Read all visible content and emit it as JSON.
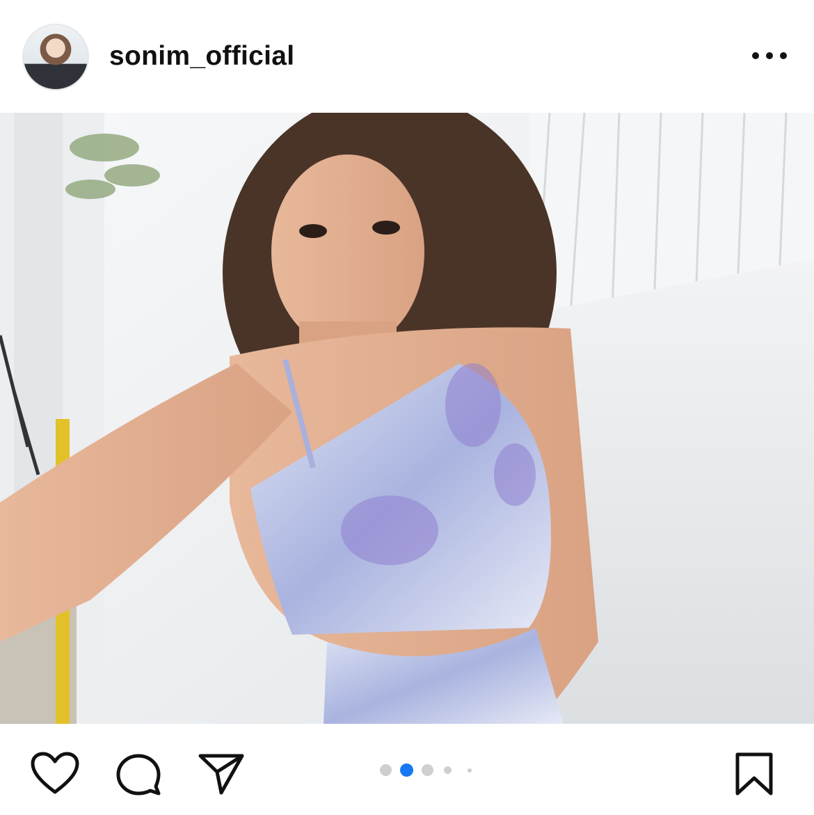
{
  "post": {
    "username": "sonim_official",
    "image_description_icon": "photo-content",
    "carousel": {
      "total": 5,
      "active": 2
    }
  },
  "icons": {
    "more": "more-horizontal-icon",
    "like": "heart-icon",
    "comment": "comment-bubble-icon",
    "share": "paper-plane-icon",
    "save": "bookmark-icon"
  },
  "colors": {
    "accent_dot": "#1877f2",
    "inactive_dot": "#cfcfcf",
    "icon_stroke": "#111111"
  }
}
